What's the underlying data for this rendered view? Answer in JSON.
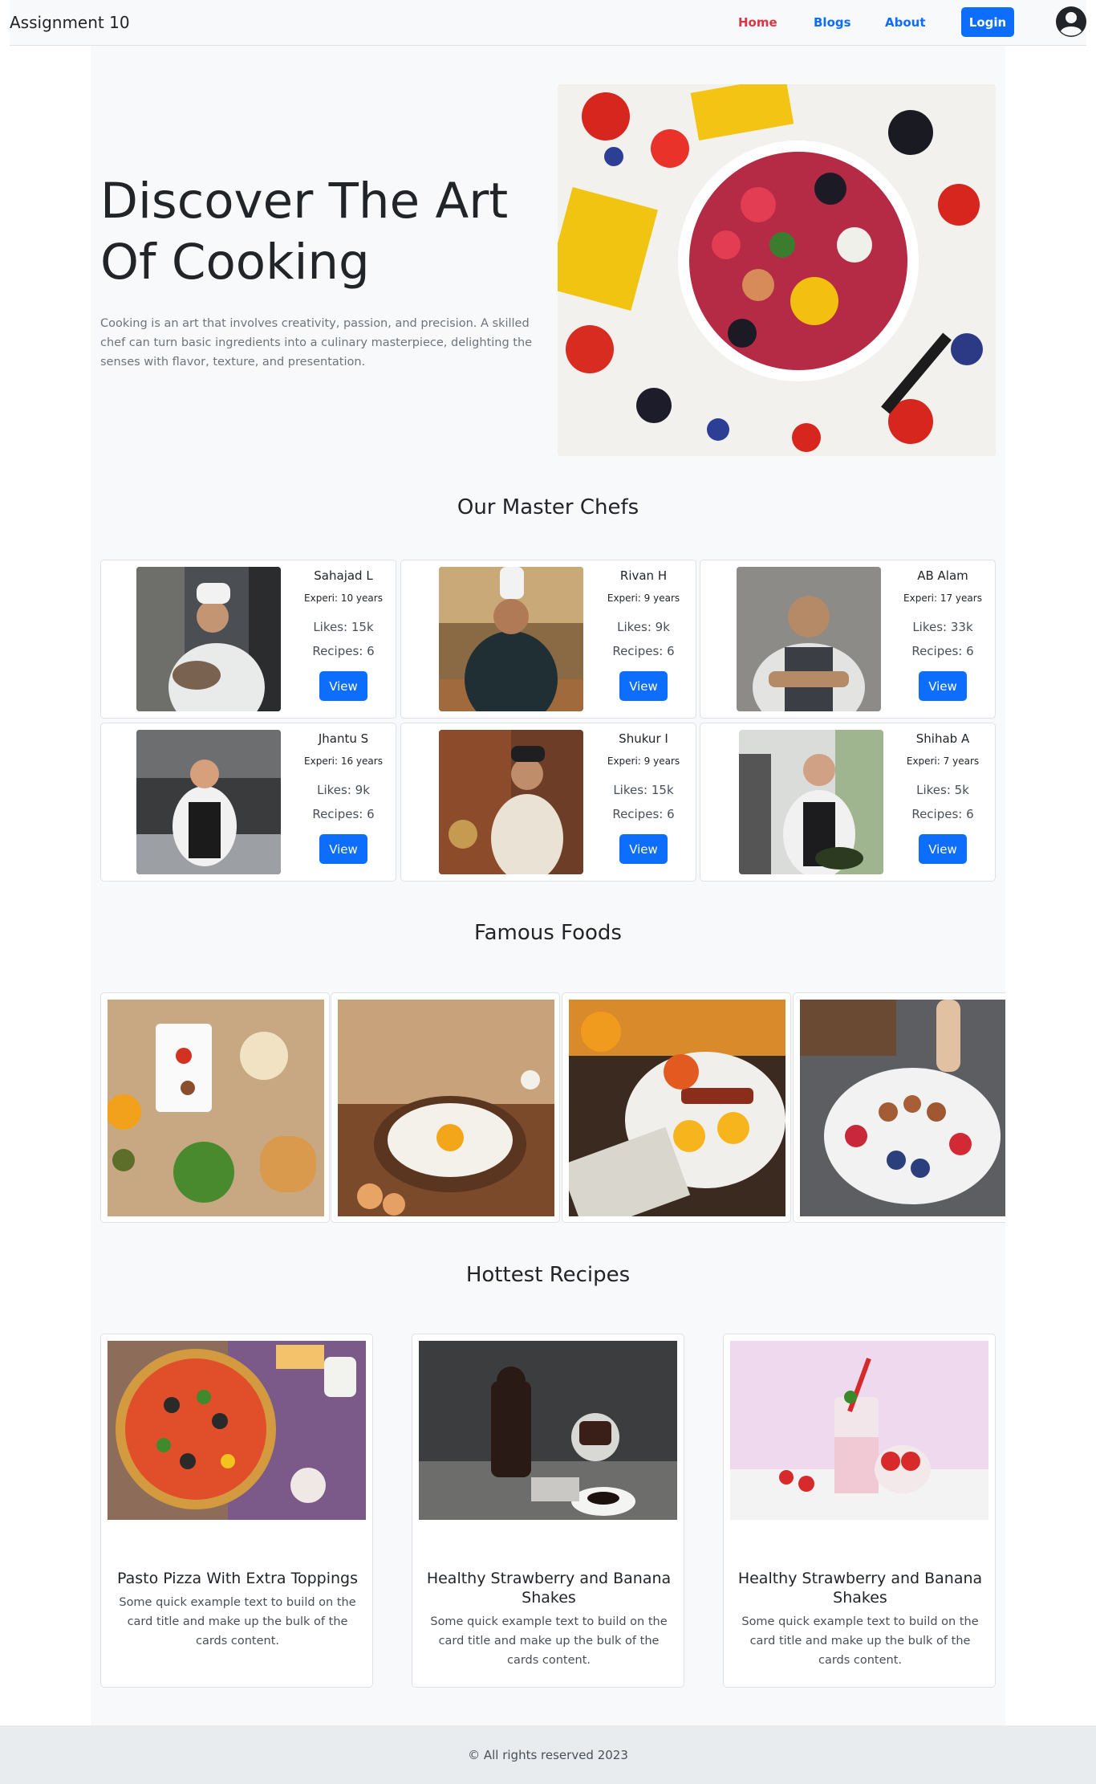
{
  "nav": {
    "brand": "Assignment 10",
    "links": [
      "Home",
      "Blogs",
      "About"
    ],
    "login_label": "Login"
  },
  "hero": {
    "title": "Discover The Art Of Cooking",
    "text": "Cooking is an art that involves creativity, passion, and precision. A skilled chef can turn basic ingredients into a culinary masterpiece, delighting the senses with flavor, texture, and presentation."
  },
  "chefs_section": {
    "title": "Our Master Chefs",
    "chefs": [
      {
        "name": "Sahajad L",
        "experience": "Experi: 10 years",
        "likes": "Likes: 15k",
        "recipes": "Recipes: 6",
        "button": "View"
      },
      {
        "name": "Rivan H",
        "experience": "Experi: 9 years",
        "likes": "Likes: 9k",
        "recipes": "Recipes: 6",
        "button": "View"
      },
      {
        "name": "AB Alam",
        "experience": "Experi: 17 years",
        "likes": "Likes: 33k",
        "recipes": "Recipes: 6",
        "button": "View"
      },
      {
        "name": "Jhantu S",
        "experience": "Experi: 16 years",
        "likes": "Likes: 9k",
        "recipes": "Recipes: 6",
        "button": "View"
      },
      {
        "name": "Shukur I",
        "experience": "Experi: 9 years",
        "likes": "Likes: 15k",
        "recipes": "Recipes: 6",
        "button": "View"
      },
      {
        "name": "Shihab A",
        "experience": "Experi: 7 years",
        "likes": "Likes: 5k",
        "recipes": "Recipes: 6",
        "button": "View"
      }
    ]
  },
  "foods_section": {
    "title": "Famous Foods"
  },
  "recipes_section": {
    "title": "Hottest Recipes",
    "recipes": [
      {
        "title": "Pasto Pizza With Extra Toppings",
        "text": "Some quick example text to build on the card title and make up the bulk of the cards content."
      },
      {
        "title": "Healthy Strawberry and Banana Shakes",
        "text": "Some quick example text to build on the card title and make up the bulk of the cards content."
      },
      {
        "title": "Healthy Strawberry and Banana Shakes",
        "text": "Some quick example text to build on the card title and make up the bulk of the cards content."
      }
    ]
  },
  "footer": {
    "text": "© All rights reserved 2023"
  },
  "colors": {
    "primary": "#0d6efd",
    "active": "#dc3545",
    "page_bg": "#f8f9fa"
  }
}
